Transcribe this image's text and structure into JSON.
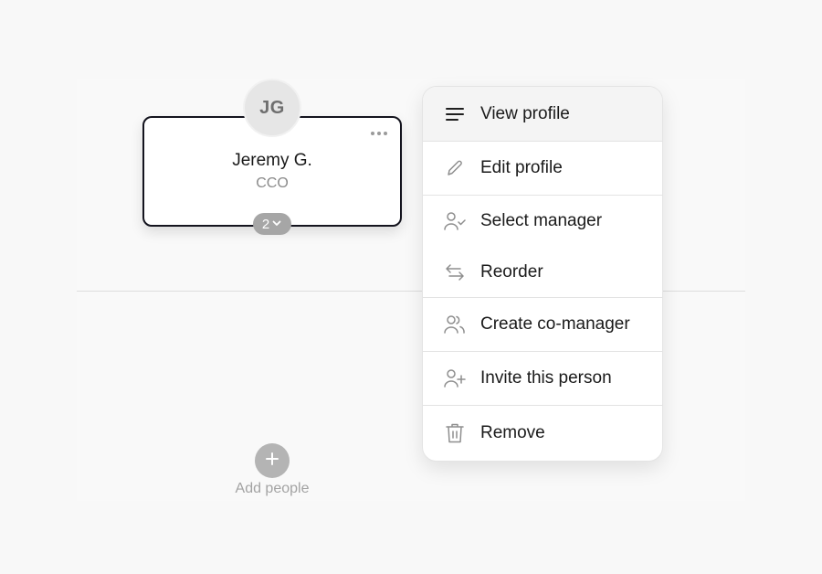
{
  "person": {
    "initials": "JG",
    "name": "Jeremy G.",
    "title": "CCO",
    "direct_reports": "2"
  },
  "add": {
    "label": "Add people"
  },
  "menu": {
    "items": [
      {
        "id": "view-profile",
        "label": "View profile",
        "icon": "lines-icon",
        "active": true
      },
      {
        "id": "edit-profile",
        "label": "Edit profile",
        "icon": "pencil-icon"
      },
      {
        "id": "select-manager",
        "label": "Select manager",
        "icon": "user-check-icon"
      },
      {
        "id": "reorder",
        "label": "Reorder",
        "icon": "swap-arrows-icon"
      },
      {
        "id": "create-co-manager",
        "label": "Create co-manager",
        "icon": "users-icon"
      },
      {
        "id": "invite-this-person",
        "label": "Invite this person",
        "icon": "user-plus-icon"
      },
      {
        "id": "remove",
        "label": "Remove",
        "icon": "trash-icon"
      }
    ]
  },
  "colors": {
    "card_border": "#14141e",
    "muted": "#a6a6a6",
    "accent_active": "#f4f4f4"
  }
}
